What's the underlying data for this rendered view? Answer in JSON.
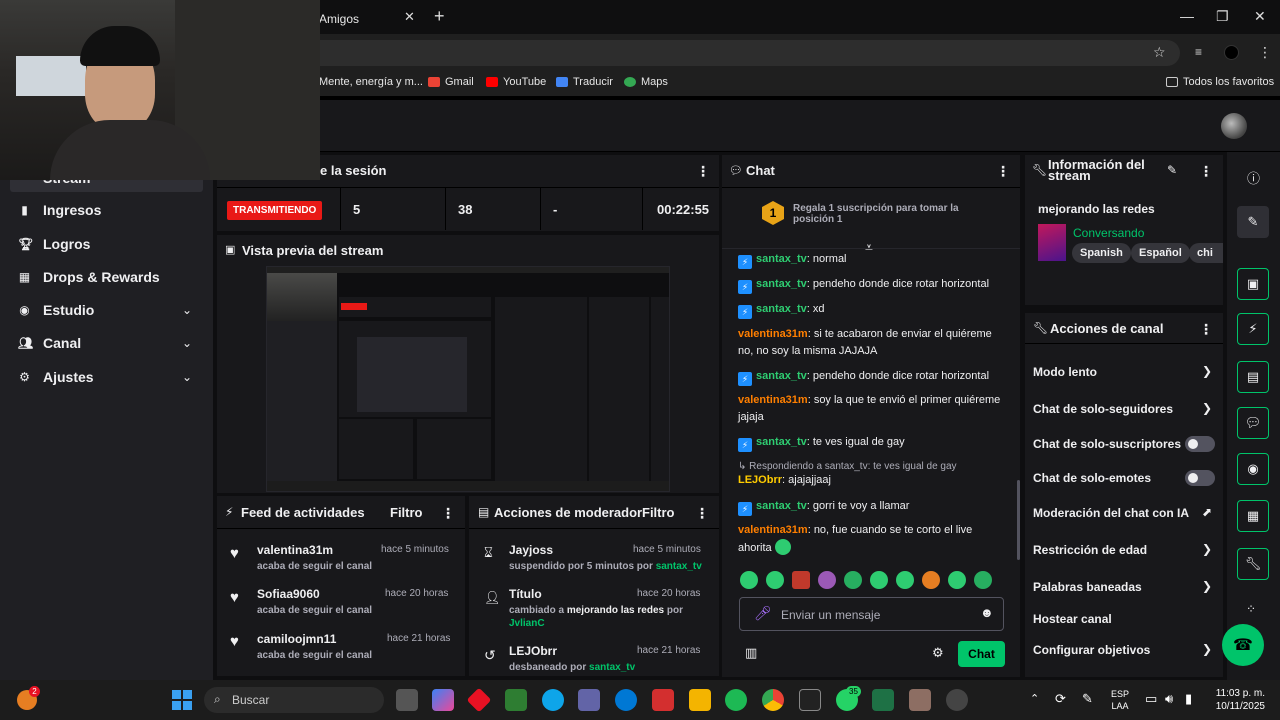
{
  "browser": {
    "tab_title": "Amigos",
    "bookmarks": [
      {
        "label": "Mente, energía y m..."
      },
      {
        "label": "Gmail"
      },
      {
        "label": "YouTube"
      },
      {
        "label": "Traducir"
      },
      {
        "label": "Maps"
      }
    ],
    "all_bookmarks": "Todos los favoritos"
  },
  "sidebar": {
    "partial_item": "Stream",
    "items": [
      {
        "label": "Ingresos",
        "icon": "bar-chart-icon"
      },
      {
        "label": "Logros",
        "icon": "trophy-icon"
      },
      {
        "label": "Drops & Rewards",
        "icon": "drops-icon"
      },
      {
        "label": "Estudio",
        "icon": "camera-icon"
      },
      {
        "label": "Canal",
        "icon": "people-icon"
      },
      {
        "label": "Ajustes",
        "icon": "gear-icon"
      }
    ]
  },
  "session": {
    "title_partial": "e la sesión",
    "status": "TRANSMITIENDO",
    "viewers": "5",
    "followers": "38",
    "subs": "-",
    "duration": "00:22:55"
  },
  "preview": {
    "title": "Vista previa del stream"
  },
  "feed": {
    "title": "Feed de actividades",
    "filter": "Filtro",
    "items": [
      {
        "name": "valentina31m",
        "time": "hace 5 minutos",
        "action": "acaba de seguir el canal"
      },
      {
        "name": "Sofiaa9060",
        "time": "hace 20 horas",
        "action": "acaba de seguir el canal"
      },
      {
        "name": "camiloojmn11",
        "time": "hace 21 horas",
        "action": "acaba de seguir el canal"
      }
    ]
  },
  "mod_actions": {
    "title": "Acciones de moderador",
    "filter": "Filtro",
    "items": [
      {
        "name": "Jayjoss",
        "time": "hace 5 minutos",
        "line_a": "suspendido por 5 minutos por",
        "line_b": "santax_tv"
      },
      {
        "name": "Título",
        "time": "hace 20 horas",
        "line_a": "cambiado a",
        "line_bold": "mejorando las redes",
        "line_c": "por",
        "line_d": "JvlianC"
      },
      {
        "name": "LEJObrr",
        "time": "hace 21 horas",
        "line_a": "desbaneado por",
        "line_b": "santax_tv"
      }
    ]
  },
  "chat": {
    "title": "Chat",
    "promo_rank": "1",
    "promo_text": "Regala 1 suscripción para tomar la posición 1",
    "messages": [
      {
        "user": "santax_tv",
        "text": ": normal"
      },
      {
        "user": "santax_tv",
        "text": ": pendeho donde dice rotar horizontal"
      },
      {
        "user": "santax_tv",
        "text": ": xd"
      },
      {
        "user": "valentina31m",
        "text": ": si te acabaron de enviar el quiéreme no, no soy la misma JAJAJA"
      },
      {
        "user": "santax_tv",
        "text": ": pendeho donde dice rotar horizontal"
      },
      {
        "user": "valentina31m",
        "text": ": soy la que te envió el primer quiéreme jajaja"
      },
      {
        "user": "santax_tv",
        "text": ": te ves igual de gay"
      },
      {
        "reply_to": "Respondiendo a santax_tv: te ves igual de gay",
        "user": "LEJObrr",
        "text": ": ajajajjaaj"
      },
      {
        "user": "santax_tv",
        "text": ": gorri te voy a llamar"
      },
      {
        "user": "valentina31m",
        "text": ": no, fue cuando se te corto el live ahorita"
      }
    ],
    "input_placeholder": "Enviar un mensaje",
    "send_label": "Chat"
  },
  "stream_info": {
    "title": "Información del stream",
    "stream_title": "mejorando las redes",
    "category": "Conversando",
    "tags": [
      "Spanish",
      "Español",
      "chi"
    ]
  },
  "channel_actions": {
    "title": "Acciones de canal",
    "items": [
      {
        "label": "Modo lento",
        "control": "chevron"
      },
      {
        "label": "Chat de solo-seguidores",
        "control": "chevron"
      },
      {
        "label": "Chat de solo-suscriptores",
        "control": "toggle"
      },
      {
        "label": "Chat de solo-emotes",
        "control": "toggle"
      },
      {
        "label": "Moderación del chat con IA",
        "control": "external"
      },
      {
        "label": "Restricción de edad",
        "control": "chevron"
      },
      {
        "label": "Palabras baneadas",
        "control": "chevron"
      },
      {
        "label": "Hostear canal",
        "control": "none"
      },
      {
        "label": "Configurar objetivos",
        "control": "chevron"
      }
    ]
  },
  "taskbar": {
    "search_placeholder": "Buscar",
    "lang_top": "ESP",
    "lang_bottom": "LAA",
    "time": "11:03 p. m.",
    "date": "10/11/2025",
    "weather_badge": "2",
    "whatsapp_badge": "35"
  },
  "colors": {
    "accent_green": "#00c46a",
    "live_red": "#e91916",
    "chat_user_green": "#2ecc71",
    "chat_user_orange": "#ff7f00"
  }
}
